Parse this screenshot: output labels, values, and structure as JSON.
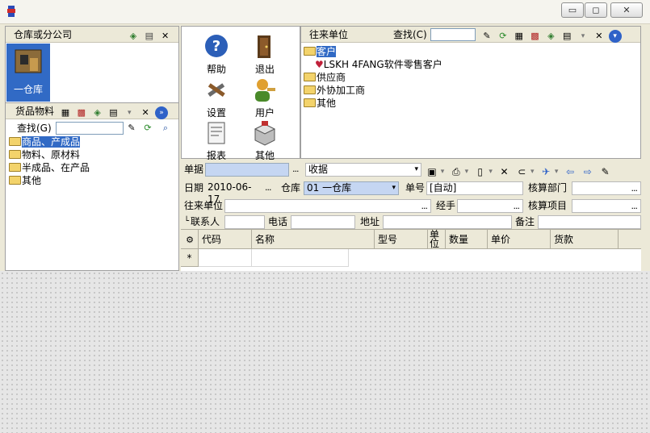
{
  "window": {
    "minimize": "▭",
    "restore": "◻",
    "close": "✕"
  },
  "warehouse_panel": {
    "title": "仓库或分公司",
    "item_label": "一仓库"
  },
  "goods_panel": {
    "title": "货品物料",
    "search_label": "查找(G)",
    "tree": [
      "商品、产成品",
      "物料、原材料",
      "半成品、在产品",
      "其他"
    ]
  },
  "launcher": {
    "items": [
      {
        "label": "帮助",
        "icon": "help-icon",
        "color": "#2c5fb8"
      },
      {
        "label": "退出",
        "icon": "exit-door-icon",
        "color": "#5a3a1a"
      },
      {
        "label": "设置",
        "icon": "settings-tools-icon",
        "color": "#6a6a6a"
      },
      {
        "label": "用户",
        "icon": "user-icon",
        "color": "#e0a030"
      },
      {
        "label": "报表",
        "icon": "report-icon",
        "color": "#7a7a7a"
      },
      {
        "label": "其他",
        "icon": "other-box-icon",
        "color": "#9a9a9a"
      }
    ]
  },
  "partner_panel": {
    "title": "往来单位",
    "search_label": "查找(C)",
    "tree": [
      {
        "label": "客户",
        "children": [
          "LSKH 4FANG软件零售客户"
        ]
      },
      {
        "label": "供应商"
      },
      {
        "label": "外协加工商"
      },
      {
        "label": "其他"
      }
    ]
  },
  "form": {
    "doc_label": "单据",
    "doc_type": "收据",
    "date_label": "日期",
    "date_value": "2010-06-17",
    "warehouse_label": "仓库",
    "warehouse_value": "01 一仓库",
    "number_label": "单号",
    "number_value": "[自动]",
    "dept_label": "核算部门",
    "partner_label": "往来单位",
    "handler_label": "经手",
    "project_label": "核算项目",
    "contact_label": "联系人",
    "phone_label": "电话",
    "address_label": "地址",
    "remark_label": "备注"
  },
  "grid": {
    "columns": [
      "代码",
      "名称",
      "型号",
      "单位",
      "数量",
      "单价",
      "货款"
    ],
    "new_row_marker": "*"
  }
}
